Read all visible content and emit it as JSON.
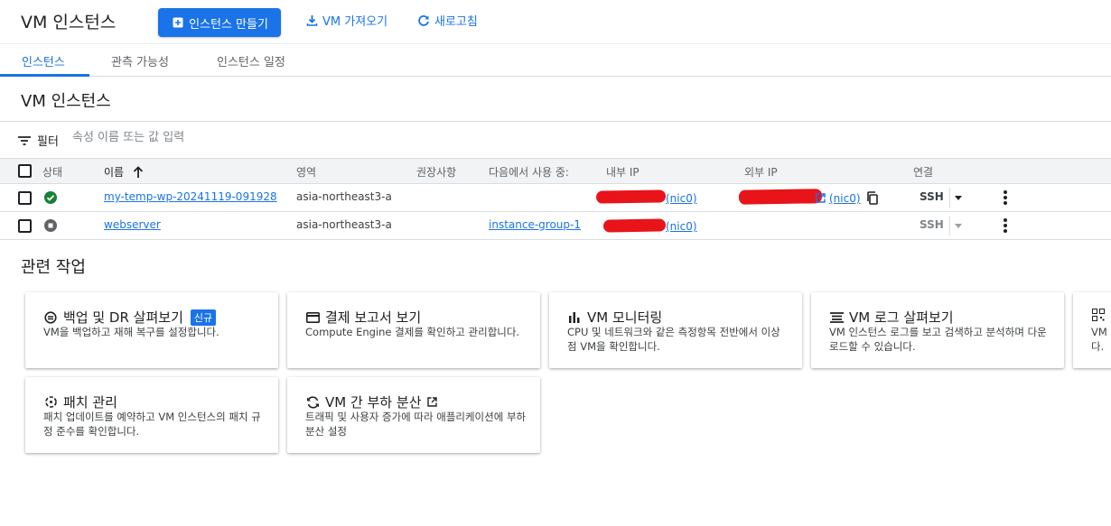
{
  "header": {
    "title": "VM 인스턴스",
    "create_label": "인스턴스 만들기",
    "import_label": "VM 가져오기",
    "refresh_label": "새로고침"
  },
  "tabs": [
    {
      "label": "인스턴스",
      "active": true
    },
    {
      "label": "관측 가능성",
      "active": false
    },
    {
      "label": "인스턴스 일정",
      "active": false
    }
  ],
  "section": {
    "title": "VM 인스턴스"
  },
  "filter": {
    "label": "필터",
    "placeholder": "속성 이름 또는 값 입력"
  },
  "table": {
    "columns": {
      "status": "상태",
      "name": "이름",
      "zone": "영역",
      "recommendation": "권장사항",
      "in_use_by": "다음에서 사용 중:",
      "internal_ip": "내부 IP",
      "external_ip": "외부 IP",
      "connect": "연결"
    },
    "rows": [
      {
        "status": "running",
        "name": "my-temp-wp-20241119-091928",
        "zone": "asia-northeast3-a",
        "in_use_by": "",
        "internal_nic": "(nic0)",
        "external_nic": "(nic0)",
        "connect": "SSH",
        "connect_enabled": true
      },
      {
        "status": "stopped",
        "name": "webserver",
        "zone": "asia-northeast3-a",
        "in_use_by": "instance-group-1",
        "internal_nic": "(nic0)",
        "external_nic": "",
        "connect": "SSH",
        "connect_enabled": false
      }
    ]
  },
  "related": {
    "title": "관련 작업",
    "cards": [
      {
        "icon": "backup-icon",
        "title": "백업 및 DR 살펴보기",
        "badge": "신규",
        "desc": "VM을 백업하고 재해 복구를 설정합니다."
      },
      {
        "icon": "billing-icon",
        "title": "결제 보고서 보기",
        "desc": "Compute Engine 결제를 확인하고 관리합니다."
      },
      {
        "icon": "chart-icon",
        "title": "VM 모니터링",
        "desc": "CPU 및 네트워크와 같은 측정항목 전반에서 이상점 VM을 확인합니다."
      },
      {
        "icon": "logs-icon",
        "title": "VM 로그 살펴보기",
        "desc": "VM 인스턴스 로그를 보고 검색하고 분석하며 다운로드할 수 있습니다."
      },
      {
        "icon": "qr-icon",
        "title": "",
        "desc": "VM 다."
      },
      {
        "icon": "patch-icon",
        "title": "패치 관리",
        "desc": "패치 업데이트를 예약하고 VM 인스턴스의 패치 규정 준수를 확인합니다."
      },
      {
        "icon": "loadbalance-icon",
        "title": "VM 간 부하 분산",
        "desc": "트래픽 및 사용자 증가에 따라 애플리케이션에 부하 분산 설정"
      }
    ]
  },
  "colors": {
    "accent": "#1a73e8",
    "running": "#188038",
    "stopped": "#5f6368",
    "redaction": "#e8141a"
  }
}
